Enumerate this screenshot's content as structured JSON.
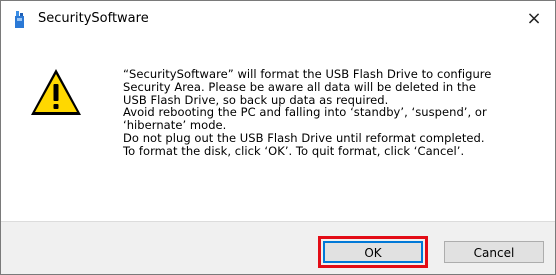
{
  "window": {
    "title": "SecuritySoftware",
    "close_glyph": "×",
    "icons": {
      "app": "usb-drive-icon",
      "warning": "warning-triangle-icon",
      "close": "close-icon"
    }
  },
  "message": {
    "lines": [
      "“SecuritySoftware” will format the USB Flash Drive to configure",
      "Security Area. Please be aware all data will be deleted in the",
      "USB Flash Drive, so back up data as required.",
      "Avoid rebooting the PC and falling into ‘standby’, ‘suspend’, or",
      "‘hibernate’ mode.",
      "Do not plug out the USB Flash Drive until reformat completed.",
      "To format the disk, click ‘OK’. To quit format, click ‘Cancel’."
    ]
  },
  "buttons": {
    "ok": "OK",
    "cancel": "Cancel"
  },
  "colors": {
    "highlight": "#e30c16",
    "focus": "#0078d7",
    "warning_fill": "#ffd800"
  }
}
